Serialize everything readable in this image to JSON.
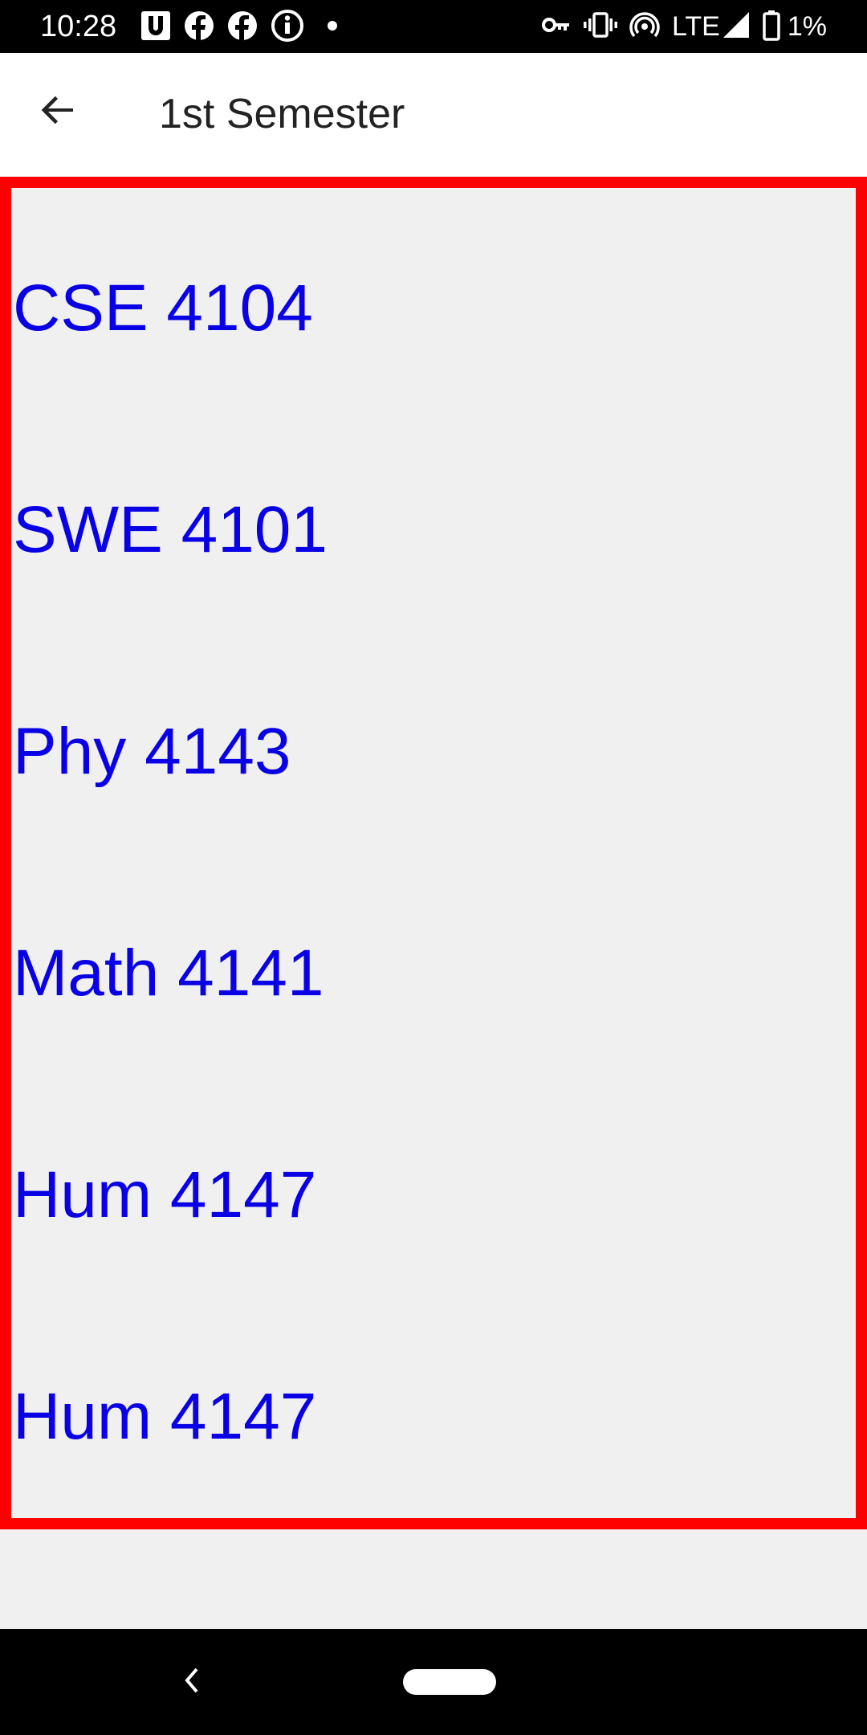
{
  "status_bar": {
    "time": "10:28",
    "network_label": "LTE",
    "battery_label": "1%",
    "left_icons": [
      "u-app-icon",
      "facebook-icon",
      "facebook-icon",
      "info-icon",
      "dot-icon"
    ],
    "right_icons": [
      "vpn-key-icon",
      "vibrate-icon",
      "hotspot-icon",
      "lte-signal-icon",
      "battery-icon"
    ]
  },
  "app_bar": {
    "title": "1st Semester"
  },
  "courses": [
    {
      "label": "CSE 4104"
    },
    {
      "label": "SWE 4101"
    },
    {
      "label": "Phy 4143"
    },
    {
      "label": "Math 4141"
    },
    {
      "label": "Hum 4147"
    },
    {
      "label": "Hum 4147"
    }
  ],
  "colors": {
    "course_text": "#0a00e6",
    "list_border": "#ff0000",
    "background": "#f0f0f0"
  }
}
